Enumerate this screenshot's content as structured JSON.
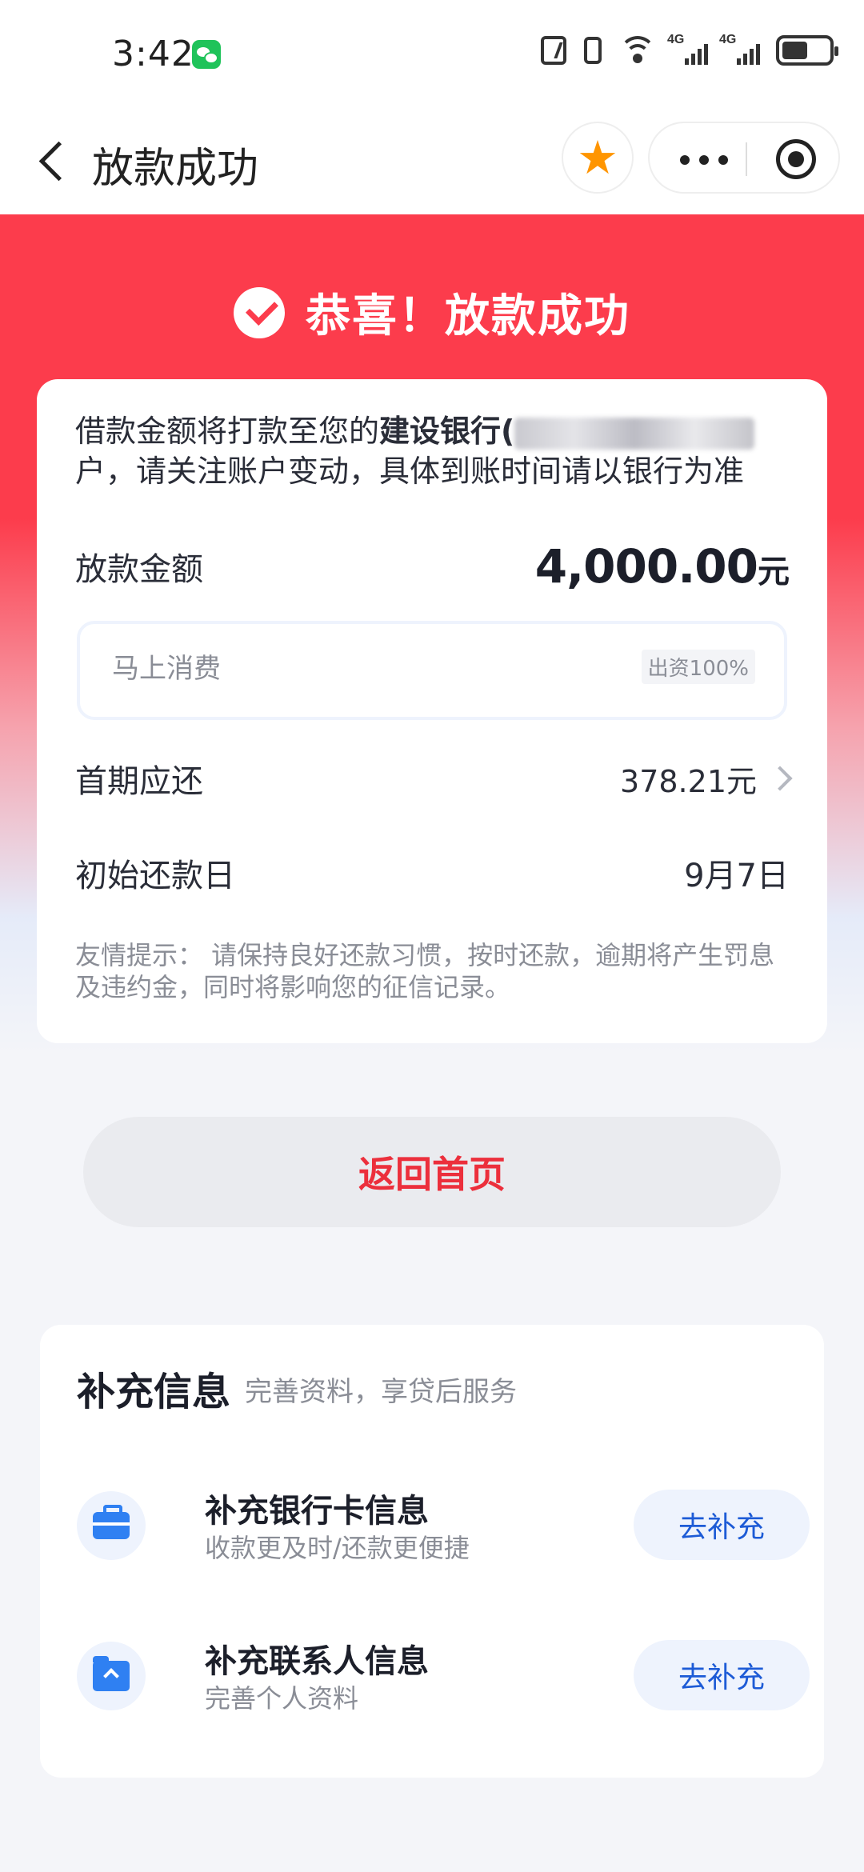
{
  "status_bar": {
    "time": "3:42",
    "net1": "4G",
    "net2": "4G"
  },
  "nav": {
    "title": "放款成功"
  },
  "hero": {
    "title": "恭喜！放款成功"
  },
  "card": {
    "notice_prefix": "借款金额将打款至您的",
    "bank_name": "建设银行(",
    "notice_suffix": "户，请关注账户变动，具体到账时间请以银行为准",
    "amount_label": "放款金额",
    "amount_value": "4,000.00",
    "amount_unit": "元",
    "lender_name": "马上消费",
    "lender_share": "出资100%",
    "first_label": "首期应还",
    "first_value": "378.21元",
    "repay_label": "初始还款日",
    "repay_value": "9月7日",
    "tip": "友情提示：  请保持良好还款习惯，按时还款，逾期将产生罚息及违约金，同时将影响您的征信记录。"
  },
  "return_button": "返回首页",
  "info": {
    "title": "补充信息",
    "subtitle": "完善资料，享贷后服务",
    "items": [
      {
        "title": "补充银行卡信息",
        "desc": "收款更及时/还款更便捷",
        "button": "去补充"
      },
      {
        "title": "补充联系人信息",
        "desc": "完善个人资料",
        "button": "去补充"
      }
    ]
  },
  "colors": {
    "brand_red": "#fc3c4c",
    "link_blue": "#1d5bd6",
    "icon_blue": "#2f80f2"
  }
}
